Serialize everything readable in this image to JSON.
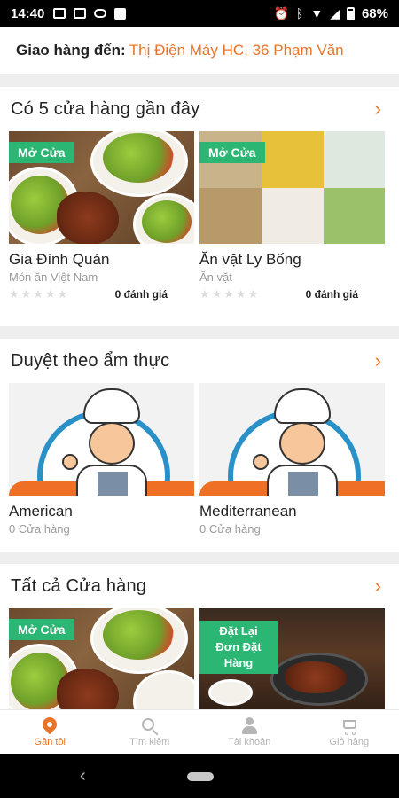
{
  "status_bar": {
    "time": "14:40",
    "battery": "68%"
  },
  "delivery": {
    "label": "Giao hàng đến:",
    "address": "Thị Điện Máy HC, 36 Phạm Văn"
  },
  "sections": [
    {
      "title": "Có 5 cửa hàng gần đây",
      "cards": [
        {
          "badge": "Mở Cửa",
          "name": "Gia Đình Quán",
          "subtitle": "Món ăn Việt Nam",
          "rating_text": "0 đánh giá",
          "stars": 0
        },
        {
          "badge": "Mở Cửa",
          "name": "Ăn vặt Ly Bống",
          "subtitle": "Ăn vặt",
          "rating_text": "0 đánh giá",
          "stars": 0
        }
      ]
    },
    {
      "title": "Duyệt theo ẩm thực",
      "cards": [
        {
          "name": "American",
          "subtitle": "0 Cửa hàng"
        },
        {
          "name": "Mediterranean",
          "subtitle": "0 Cửa hàng"
        }
      ]
    },
    {
      "title": "Tất cả Cửa hàng",
      "cards": [
        {
          "badge": "Mở Cửa"
        },
        {
          "badge": "Đặt Lại Đơn Đặt Hàng"
        }
      ]
    }
  ],
  "bottom_nav": [
    {
      "label": "Gần tôi",
      "icon": "location-pin-icon",
      "active": true
    },
    {
      "label": "Tìm kiếm",
      "icon": "search-icon",
      "active": false
    },
    {
      "label": "Tài khoản",
      "icon": "user-icon",
      "active": false
    },
    {
      "label": "Giỏ hàng",
      "icon": "cart-icon",
      "active": false
    }
  ],
  "colors": {
    "accent": "#e8742a",
    "open_badge": "#2bb673",
    "chef_ring": "#2a91c8"
  }
}
